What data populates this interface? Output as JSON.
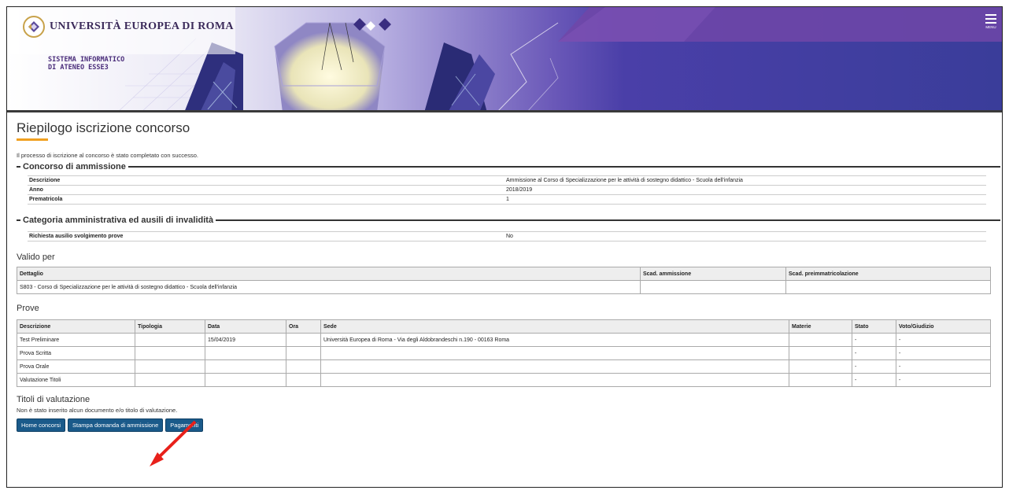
{
  "header": {
    "university": "UNIVERSITÀ EUROPEA DI ROMA",
    "system_line1": "SISTEMA INFORMATICO",
    "system_line2": "DI ATENEO ESSE3",
    "menu_label": "MENU",
    "colors": {
      "banner": "#3a3d9a",
      "accent": "#6a3ea0"
    }
  },
  "page": {
    "title": "Riepilogo iscrizione concorso",
    "message": "Il processo di iscrizione al concorso è stato completato con successo."
  },
  "concorso": {
    "legend": "Concorso di ammissione",
    "rows": [
      {
        "label": "Descrizione",
        "value": "Ammissione al Corso di Specializzazione per le attività di sostegno didattico - Scuola dell'infanzia"
      },
      {
        "label": "Anno",
        "value": "2018/2019"
      },
      {
        "label": "Prematricola",
        "value": "1"
      }
    ]
  },
  "categoria": {
    "legend": "Categoria amministrativa ed ausili di invalidità",
    "rows": [
      {
        "label": "Richiesta ausilio svolgimento prove",
        "value": "No"
      }
    ]
  },
  "valido": {
    "title": "Valido per",
    "headers": [
      "Dettaglio",
      "Scad. ammissione",
      "Scad. preimmatricolazione"
    ],
    "rows": [
      [
        "S803 - Corso di Specializzazione per le attività di sostegno didattico - Scuola dell'infanzia",
        "",
        ""
      ]
    ]
  },
  "prove": {
    "title": "Prove",
    "headers": [
      "Descrizione",
      "Tipologia",
      "Data",
      "Ora",
      "Sede",
      "Materie",
      "Stato",
      "Voto/Giudizio"
    ],
    "rows": [
      [
        "Test Preliminare",
        "",
        "15/04/2019",
        "",
        "Università Europea di Roma - Via degli Aldobrandeschi n.190 - 00163 Roma",
        "",
        "-",
        "-"
      ],
      [
        "Prova Scritta",
        "",
        "",
        "",
        "",
        "",
        "-",
        "-"
      ],
      [
        "Prova Orale",
        "",
        "",
        "",
        "",
        "",
        "-",
        "-"
      ],
      [
        "Valutazione Titoli",
        "",
        "",
        "",
        "",
        "",
        "-",
        "-"
      ]
    ]
  },
  "titoli": {
    "title": "Titoli di valutazione",
    "message": "Non è stato inserito alcun documento e/o titolo di valutazione."
  },
  "buttons": {
    "home": "Home concorsi",
    "stampa": "Stampa domanda di ammissione",
    "pagamenti": "Pagamenti",
    "color": "#1a5a8a"
  },
  "annotation": {
    "arrow_color": "#e8201a"
  }
}
